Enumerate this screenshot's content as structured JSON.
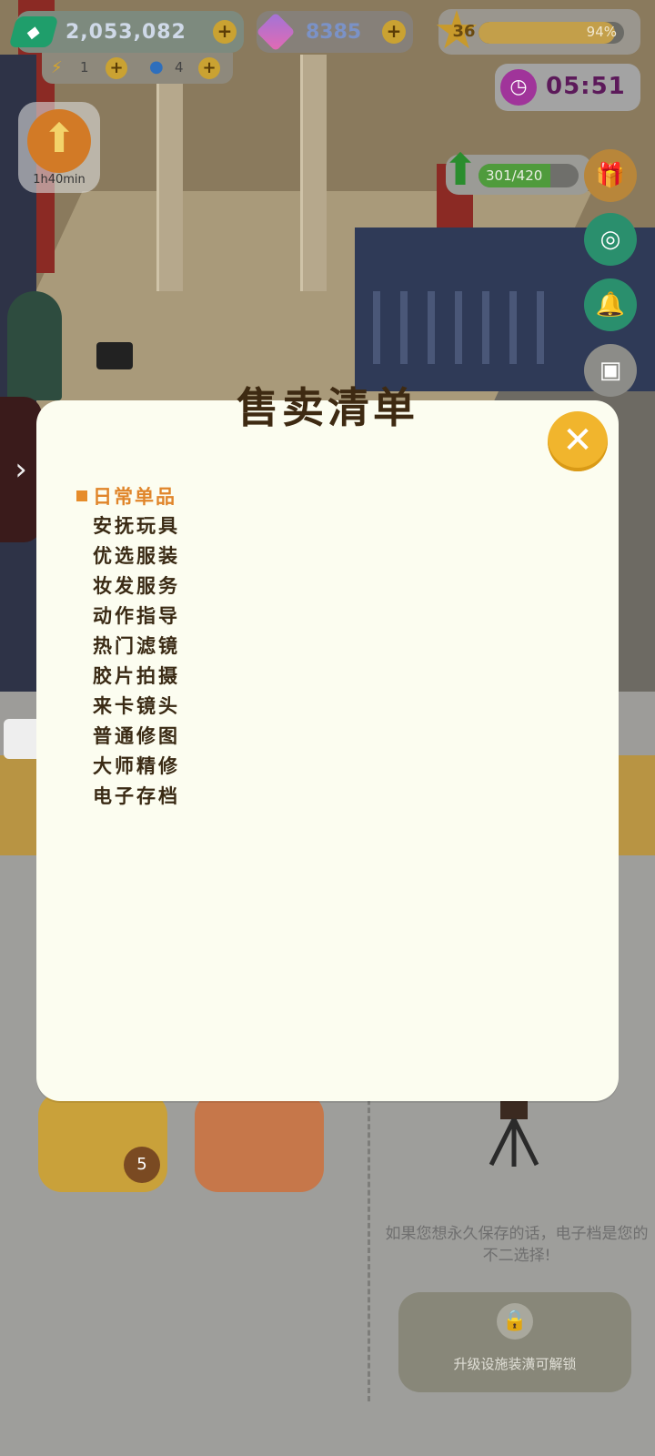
{
  "hud": {
    "money": "2,053,082",
    "energy_value": "1",
    "water_value": "4",
    "gems": "8385",
    "level": "36",
    "xp_percent_label": "94%",
    "xp_fraction": 0.94,
    "timer": "05:51",
    "stamina_label": "301/420",
    "stamina_fraction": 0.717,
    "upgrade_time": "1h40min"
  },
  "modal": {
    "title": "售卖清单",
    "close_symbol": "✕",
    "category": "日常单品",
    "items": [
      "安抚玩具",
      "优选服装",
      "妆发服务",
      "动作指导",
      "热门滤镜",
      "胶片拍摄",
      "来卡镜头",
      "普通修图",
      "大师精修",
      "电子存档"
    ]
  },
  "lower": {
    "badge_count": "5",
    "hint_text": "如果您想永久保存的话，电子档是您的不二选择!",
    "unlock_label": "升级设施装潢可解锁"
  },
  "colors": {
    "modal_bg": "#fcfdf0",
    "category_accent": "#e68c2a",
    "close_button": "#f1b52d",
    "title_text": "#3e2a12"
  },
  "icons": {
    "money": "banknote-icon",
    "gem": "gem-icon",
    "level": "star-icon",
    "timer": "clock-icon",
    "stamina": "up-arrow-icon",
    "close": "close-icon"
  }
}
